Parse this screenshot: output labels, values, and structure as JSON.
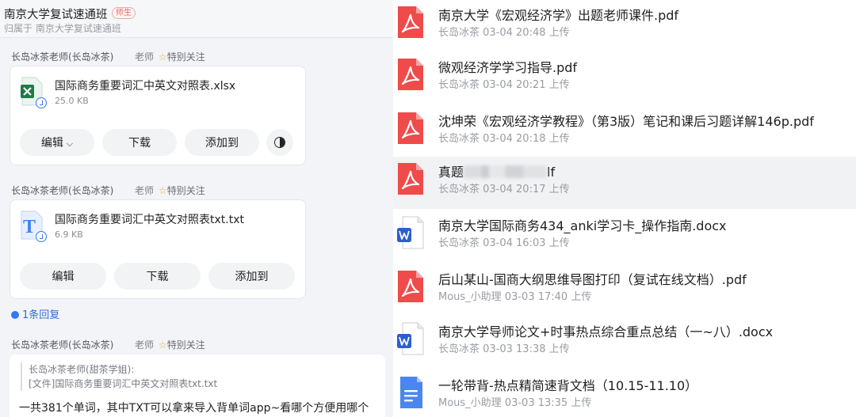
{
  "group": {
    "title": "南京大学复试速通班",
    "role_tag": "师生",
    "subtitle": "归属于 南京大学复试速通班"
  },
  "messages": [
    {
      "sender": "长岛冰茶老师(长岛冰茶)",
      "role": "老师",
      "follow": "特别关注",
      "file_name": "国际商务重要词汇中英文对照表.xlsx",
      "file_size": "25.0 KB",
      "file_icon": "excel-icon",
      "buttons": [
        "编辑",
        "下载",
        "添加到"
      ]
    },
    {
      "sender": "长岛冰茶老师(长岛冰茶)",
      "role": "老师",
      "follow": "特别关注",
      "file_name": "国际商务重要词汇中英文对照表txt.txt",
      "file_size": "6.9 KB",
      "file_icon": "text-file-icon",
      "buttons": [
        "编辑",
        "下载",
        "添加到"
      ]
    },
    {
      "sender": "长岛冰茶老师(长岛冰茶)",
      "role": "老师",
      "follow": "特别关注",
      "quote_author": "长岛冰茶老师(甜茶学姐):",
      "quote_text": "[文件]国际商务重要词汇中英文对照表txt.txt",
      "text": "一共381个单词，其中TXT可以拿来导入背单词app~看哪个方便用哪个"
    }
  ],
  "reply_count": "1条回复",
  "files": [
    {
      "name": "南京大学《宏观经济学》出题老师课件.pdf",
      "meta": "长岛冰茶 03-04 20:48 上传",
      "icon": "pdf-icon"
    },
    {
      "name": "微观经济学学习指导.pdf",
      "meta": "长岛冰茶 03-04 20:21 上传",
      "icon": "pdf-icon"
    },
    {
      "name": "沈坤荣《宏观经济学教程》（第3版）笔记和课后习题详解146p.pdf",
      "meta": "长岛冰茶 03-04 20:18 上传",
      "icon": "pdf-icon"
    },
    {
      "name_prefix": "真题",
      "name_suffix": "lf",
      "meta": "长岛冰茶 03-04 20:17 上传",
      "icon": "pdf-icon"
    },
    {
      "name": "南京大学国际商务434_anki学习卡_操作指南.docx",
      "meta": "长岛冰茶 03-04 16:03 上传",
      "icon": "word-icon"
    },
    {
      "name": "后山某山-国商大纲思维导图打印（复试在线文档）.pdf",
      "meta": "Mous_小助理 03-03 17:40 上传",
      "icon": "pdf-icon"
    },
    {
      "name": "南京大学导师论文+时事热点综合重点总结（一~八）.docx",
      "meta": "长岛冰茶 03-03 13:38 上传",
      "icon": "word-icon"
    },
    {
      "name": "一轮带背-热点精简速背文档（10.15-11.10）",
      "meta": "Mous_小助理 03-03 13:35 上传",
      "icon": "online-doc-icon"
    }
  ],
  "colors": {
    "pdf": "#f04b4b",
    "word": "#2b5fcf",
    "excel": "#1e7b45",
    "accent": "#3478f6",
    "highlight_row": "#f1f2f4"
  }
}
